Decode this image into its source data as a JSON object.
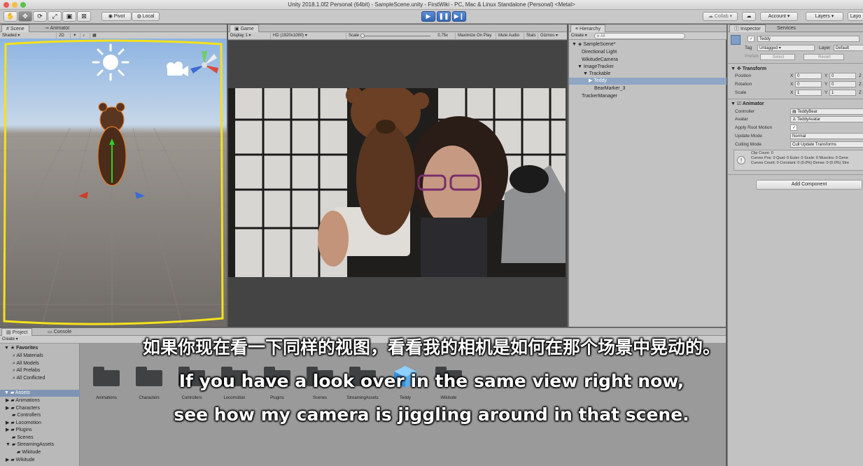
{
  "window": {
    "title": "Unity 2018.1.0f2 Personal (64bit) - SampleScene.unity - FirstWiki - PC, Mac & Linux Standalone (Personal) <Metal>"
  },
  "toolbar": {
    "pivot_label": "Pivot",
    "local_label": "Local",
    "collab_label": "Collab",
    "account_label": "Account",
    "layers_label": "Layers",
    "layout_label": "Layo"
  },
  "scene": {
    "tab_label": "Scene",
    "animator_tab_label": "Animator",
    "shading_mode": "Shaded"
  },
  "game": {
    "tab_label": "Game",
    "display": "Display 1",
    "resolution": "HD (1920x1080)",
    "scale_label": "Scale",
    "scale_value": "0.75x",
    "maximize_label": "Maximize On Play",
    "mute_label": "Mute Audio",
    "stats_label": "Stats",
    "gizmos_label": "Gizmos"
  },
  "hierarchy": {
    "tab_label": "Hierarchy",
    "create_label": "Create",
    "search_placeholder": "All",
    "items": [
      {
        "label": "SampleScene*"
      },
      {
        "label": "Directional Light"
      },
      {
        "label": "WikitudeCamera"
      },
      {
        "label": "ImageTracker"
      },
      {
        "label": "Trackable"
      },
      {
        "label": "Teddy"
      },
      {
        "label": "BearMarker_3"
      },
      {
        "label": "TrackerManager"
      }
    ]
  },
  "inspector": {
    "tab_label": "Inspector",
    "services_tab_label": "Services",
    "object_name": "Teddy",
    "tag_label": "Tag",
    "tag_value": "Untagged",
    "layer_label": "Layer",
    "layer_value": "Default",
    "prefab_label": "Prefab",
    "prefab_select": "Select",
    "prefab_revert": "Revert",
    "transform": {
      "header": "Transform",
      "position_label": "Position",
      "rotation_label": "Rotation",
      "scale_label": "Scale",
      "position": {
        "x": "0",
        "y": "0"
      },
      "rotation": {
        "x": "0",
        "y": "0"
      },
      "scale": {
        "x": "1",
        "y": "1"
      }
    },
    "animator": {
      "header": "Animator",
      "controller_label": "Controller",
      "controller_value": "TeddyBear",
      "avatar_label": "Avatar",
      "avatar_value": "TeddyAvatar",
      "root_motion_label": "Apply Root Motion",
      "update_mode_label": "Update Mode",
      "update_mode_value": "Normal",
      "culling_mode_label": "Culling Mode",
      "culling_mode_value": "Cull Update Transforms",
      "info_line1": "Clip Count: 0",
      "info_line2": "Curves Pos: 0 Quat: 0 Euler: 0 Scale: 0 Muscles: 0 Gene",
      "info_line3": "Curves Count: 0 Constant: 0 (0.0%) Dense: 0 (0.0%) Stre"
    },
    "add_component_label": "Add Component"
  },
  "project": {
    "tab_label": "Project",
    "console_tab_label": "Console",
    "create_label": "Create",
    "favorites_label": "Favorites",
    "favorites": [
      "All Materials",
      "All Models",
      "All Prefabs",
      "All Conflicted"
    ],
    "assets_label": "Assets",
    "tree": [
      "Animations",
      "Characters",
      "Controllers",
      "Locomotion",
      "Plugins",
      "Scenes",
      "StreamingAssets",
      "Wikitude",
      "Wikitude"
    ],
    "grid": [
      "Animations",
      "Characters",
      "Controllers",
      "Locomotion",
      "Plugins",
      "Scenes",
      "StreamingAssets",
      "Teddy",
      "Wikitude"
    ]
  },
  "subtitles": {
    "chinese": "如果你现在看一下同样的视图，看看我的相机是如何在那个场景中晃动的。",
    "english_line1": "If you have a look over in the same view right now,",
    "english_line2": "see how my camera is jiggling around in that scene."
  }
}
